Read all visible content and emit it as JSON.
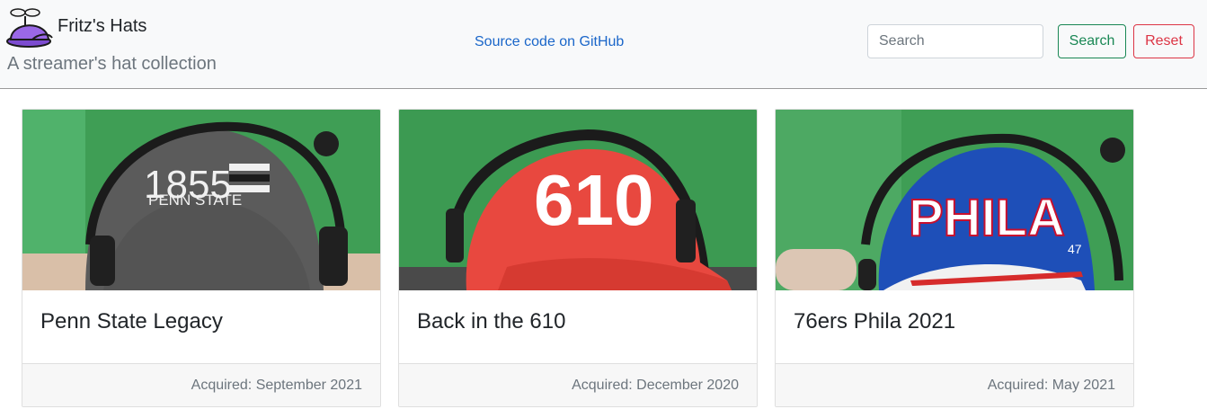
{
  "brand": {
    "title": "Fritz's Hats",
    "subtitle": "A streamer's hat collection",
    "logo_icon": "propeller-hat-icon"
  },
  "nav": {
    "github_link": "Source code on GitHub"
  },
  "search": {
    "placeholder": "Search",
    "value": "",
    "search_label": "Search",
    "reset_label": "Reset"
  },
  "colors": {
    "navbar_bg": "#f8f9fa",
    "link": "#1a66c9",
    "success": "#198754",
    "danger": "#dc3545",
    "green_screen": "#3f9e55"
  },
  "hats": [
    {
      "title": "Penn State Legacy",
      "acquired": "Acquired: September 2021",
      "image_icon": "gray-cap-photo",
      "cap_text_main": "1855",
      "cap_text_sub": "PENN STATE",
      "cap_color": "#5b5b5b"
    },
    {
      "title": "Back in the 610",
      "acquired": "Acquired: December 2020",
      "image_icon": "red-cap-photo",
      "cap_text_main": "610",
      "cap_color": "#e8483f"
    },
    {
      "title": "76ers Phila 2021",
      "acquired": "Acquired: May 2021",
      "image_icon": "blue-cap-photo",
      "cap_text_main": "PHILA",
      "cap_text_side": "47",
      "cap_color": "#1e4fb8"
    }
  ]
}
